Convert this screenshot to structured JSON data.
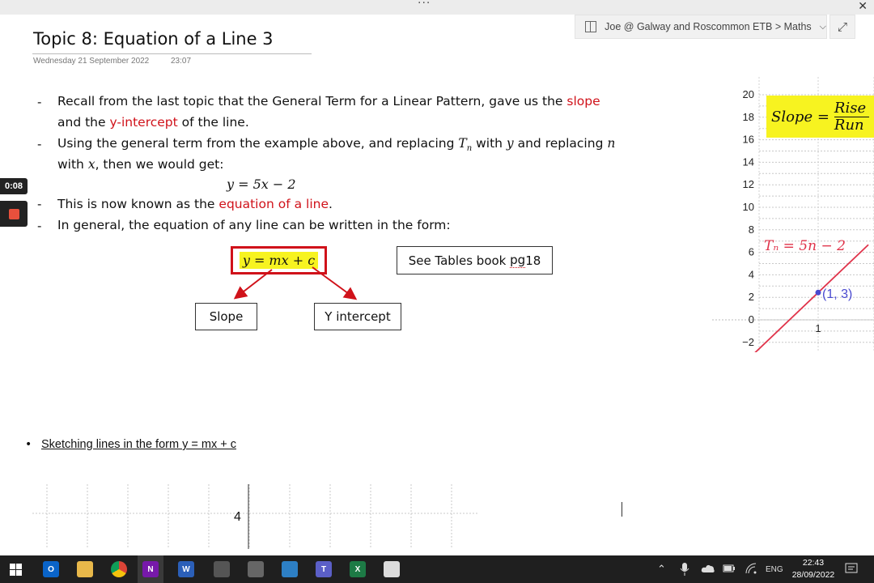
{
  "window": {
    "dots": "···",
    "close": "✕"
  },
  "notebook": {
    "breadcrumb": "Joe @ Galway and Roscommon ETB > Maths",
    "chevron": "⌵",
    "expand": "⤢"
  },
  "page": {
    "title": "Topic 8: Equation of a Line 3",
    "date": "Wednesday 21 September 2022",
    "time": "23:07"
  },
  "recorder": {
    "elapsed": "0:08"
  },
  "notes": {
    "l1a": "Recall from the last topic that the General Term for a Linear Pattern, gave us the ",
    "l1b": "slope",
    "l2a": "and the ",
    "l2b": "y-intercept",
    "l2c": " of the line.",
    "l3a": "Using the general term from the example above, and replacing ",
    "l3b": "T",
    "l3c": "n",
    "l3d": " with ",
    "l3e": "y",
    "l3f": " and replacing ",
    "l3g": "n",
    "l4a": "with ",
    "l4b": "x",
    "l4c": ", then we would get:",
    "equation": "y = 5x − 2",
    "l5a": "This is now known as the ",
    "l5b": "equation of a line",
    "l5c": ".",
    "l6": "In general, the equation of any line can be written in the form:",
    "dash": "-"
  },
  "boxes": {
    "general_form": "y = mx + c",
    "tables_ref_a": "See Tables book ",
    "tables_ref_b": "pg",
    "tables_ref_c": " 18",
    "slope": "Slope",
    "y_intercept": "Y intercept"
  },
  "graph": {
    "y_ticks": [
      "20",
      "18",
      "16",
      "14",
      "12",
      "10",
      "8",
      "6",
      "4",
      "2",
      "0",
      "−2"
    ],
    "x_tick": "1",
    "slope_label": "Slope =",
    "rise": "Rise",
    "run": "Run",
    "line_label": "Tₙ = 5n − 2",
    "point_label": "(1, 3)",
    "line_color": "#e0334a",
    "point_color": "#4a4ad0"
  },
  "bottom": {
    "bullet": "•",
    "heading": "Sketching lines in the form y = mx + c",
    "axis_tick": "4"
  },
  "taskbar": {
    "apps": [
      "outlook-icon",
      "file-explorer-icon",
      "chrome-icon",
      "onenote-icon",
      "word-icon",
      "calculator-icon",
      "phone-icon",
      "browser-icon",
      "teams-icon",
      "excel-icon",
      "settings-icon"
    ],
    "tray": {
      "up": "⌃",
      "lang": "ENG"
    },
    "time": "22:43",
    "date": "28/09/2022"
  },
  "colors": {
    "accent_red": "#d0121a",
    "highlight": "#f7f320",
    "onenote_purple": "#7719aa"
  }
}
